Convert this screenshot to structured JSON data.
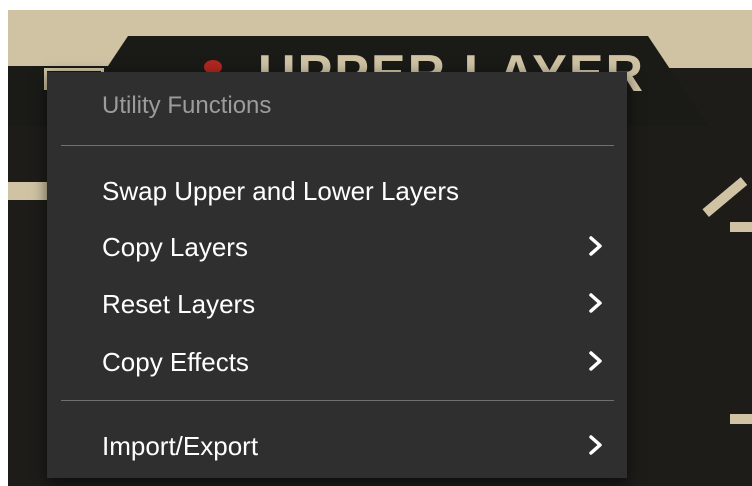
{
  "background": {
    "layer_label": "UPPER LAYER",
    "colors": {
      "panel": "#1d1c19",
      "cream": "#cfc3a4",
      "led": "#b3261f"
    }
  },
  "menu": {
    "header": "Utility Functions",
    "items": [
      {
        "label": "Swap Upper and Lower Layers",
        "has_submenu": false
      },
      {
        "label": "Copy Layers",
        "has_submenu": true,
        "icon": "chevron-right-icon"
      },
      {
        "label": "Reset Layers",
        "has_submenu": true,
        "icon": "chevron-right-icon"
      },
      {
        "label": "Copy Effects",
        "has_submenu": true,
        "icon": "chevron-right-icon"
      },
      {
        "label": "Import/Export",
        "has_submenu": true,
        "icon": "chevron-right-icon"
      }
    ],
    "colors": {
      "background": "#2f2f2f",
      "text": "#ffffff",
      "header_text": "#9c9c9c",
      "separator": "#707070"
    }
  }
}
